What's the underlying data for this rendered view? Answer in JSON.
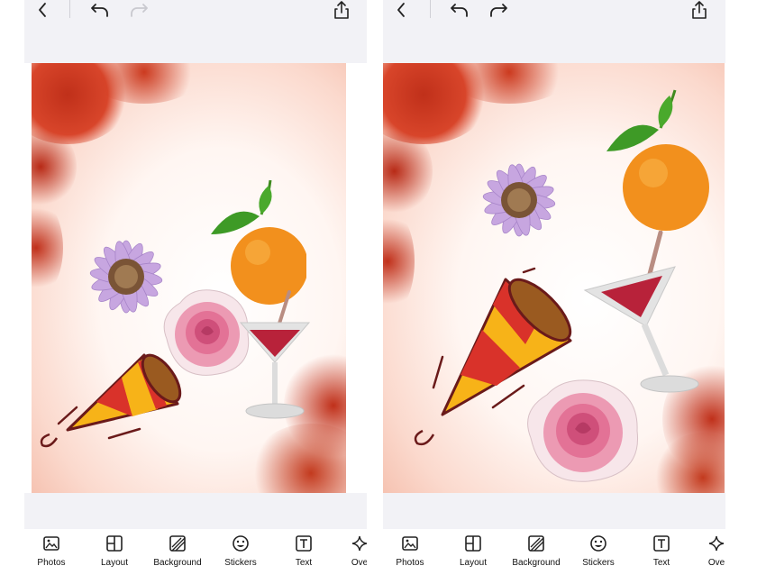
{
  "colors": {
    "bar_background": "#f2f2f6",
    "flower_red": "#c0301a",
    "glow": "#fde3d8"
  },
  "icons": {
    "back": "chevron-left-icon",
    "undo": "undo-icon",
    "redo": "redo-icon",
    "share": "share-icon"
  },
  "panels": [
    {
      "redo_enabled": false,
      "toolbar": [
        {
          "label": "Photos",
          "icon": "photos-icon"
        },
        {
          "label": "Layout",
          "icon": "layout-icon"
        },
        {
          "label": "Background",
          "icon": "background-icon"
        },
        {
          "label": "Stickers",
          "icon": "stickers-icon"
        },
        {
          "label": "Text",
          "icon": "text-icon"
        },
        {
          "label": "Ove",
          "icon": "sparkle-icon"
        }
      ],
      "stickers": [
        "purple daisy",
        "orange",
        "rose",
        "cocktail glass",
        "party horn"
      ]
    },
    {
      "redo_enabled": true,
      "toolbar": [
        {
          "label": "Photos",
          "icon": "photos-icon"
        },
        {
          "label": "Layout",
          "icon": "layout-icon"
        },
        {
          "label": "Background",
          "icon": "background-icon"
        },
        {
          "label": "Stickers",
          "icon": "stickers-icon"
        },
        {
          "label": "Text",
          "icon": "text-icon"
        },
        {
          "label": "Ove",
          "icon": "sparkle-icon"
        }
      ],
      "stickers": [
        "purple daisy",
        "orange",
        "party horn",
        "cocktail glass",
        "rose"
      ]
    }
  ]
}
